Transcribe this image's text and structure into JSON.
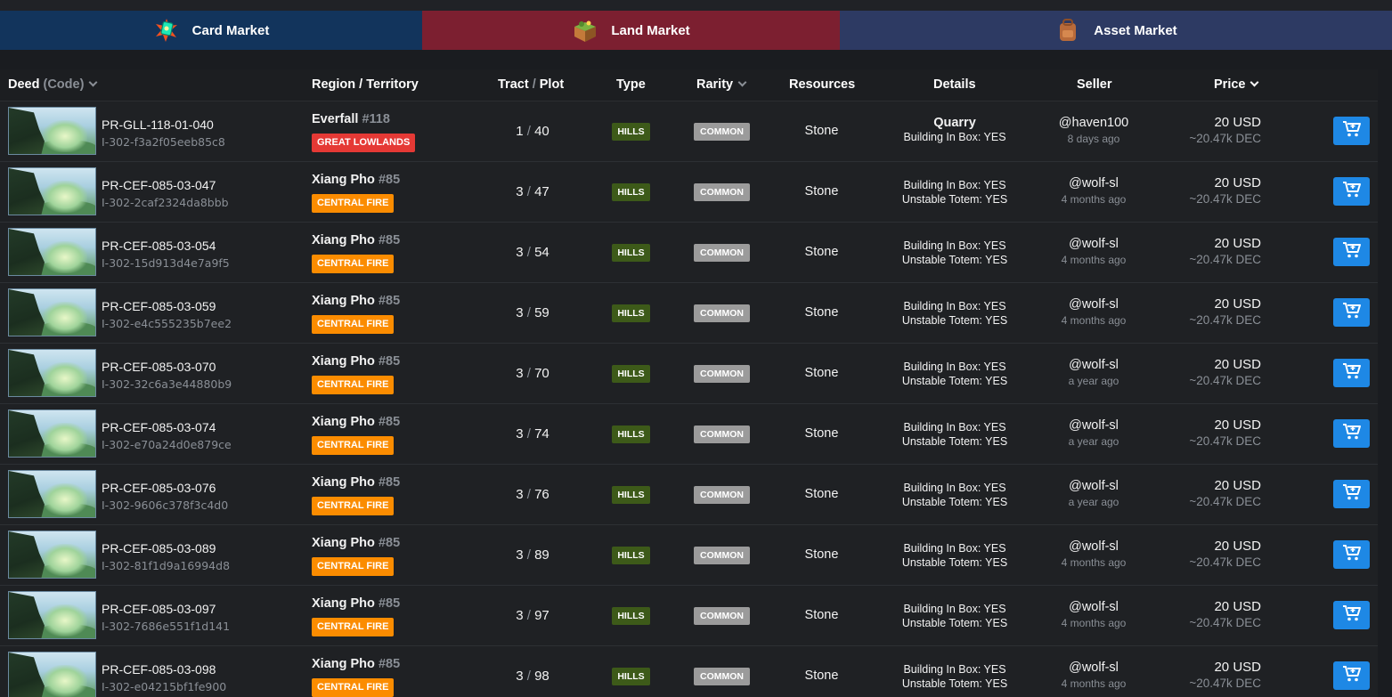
{
  "tabs": [
    {
      "label": "Card Market",
      "icon": "card-pack-icon"
    },
    {
      "label": "Land Market",
      "icon": "land-cube-icon"
    },
    {
      "label": "Asset Market",
      "icon": "backpack-icon"
    }
  ],
  "headers": {
    "deed": "Deed",
    "code": "(Code)",
    "region": "Region / Territory",
    "tract": "Tract",
    "plot": "Plot",
    "tract_sep": "/",
    "type": "Type",
    "rarity": "Rarity",
    "resources": "Resources",
    "details": "Details",
    "seller": "Seller",
    "price": "Price"
  },
  "colors": {
    "great_lowlands": "#e53935",
    "central_fire": "#fb8c00",
    "hills": "#3d5a19",
    "common": "#9b9b9b",
    "cart_button": "#1e88e5"
  },
  "rows": [
    {
      "deed": "PR-GLL-118-01-040",
      "id": "I-302-f3a2f05eeb85c8",
      "region": "Everfall",
      "region_num": "#118",
      "territory": "GREAT LOWLANDS",
      "tract": "1",
      "plot": "40",
      "type": "HILLS",
      "rarity": "COMMON",
      "resource": "Stone",
      "detail_main": "Quarry",
      "details": [
        "Building In Box: YES"
      ],
      "seller": "@haven100",
      "ago": "8 days ago",
      "price": "20 USD",
      "dec": "~20.47k DEC"
    },
    {
      "deed": "PR-CEF-085-03-047",
      "id": "I-302-2caf2324da8bbb",
      "region": "Xiang Pho",
      "region_num": "#85",
      "territory": "CENTRAL FIRE",
      "tract": "3",
      "plot": "47",
      "type": "HILLS",
      "rarity": "COMMON",
      "resource": "Stone",
      "detail_main": "",
      "details": [
        "Building In Box: YES",
        "Unstable Totem: YES"
      ],
      "seller": "@wolf-sl",
      "ago": "4 months ago",
      "price": "20 USD",
      "dec": "~20.47k DEC"
    },
    {
      "deed": "PR-CEF-085-03-054",
      "id": "I-302-15d913d4e7a9f5",
      "region": "Xiang Pho",
      "region_num": "#85",
      "territory": "CENTRAL FIRE",
      "tract": "3",
      "plot": "54",
      "type": "HILLS",
      "rarity": "COMMON",
      "resource": "Stone",
      "detail_main": "",
      "details": [
        "Building In Box: YES",
        "Unstable Totem: YES"
      ],
      "seller": "@wolf-sl",
      "ago": "4 months ago",
      "price": "20 USD",
      "dec": "~20.47k DEC"
    },
    {
      "deed": "PR-CEF-085-03-059",
      "id": "I-302-e4c555235b7ee2",
      "region": "Xiang Pho",
      "region_num": "#85",
      "territory": "CENTRAL FIRE",
      "tract": "3",
      "plot": "59",
      "type": "HILLS",
      "rarity": "COMMON",
      "resource": "Stone",
      "detail_main": "",
      "details": [
        "Building In Box: YES",
        "Unstable Totem: YES"
      ],
      "seller": "@wolf-sl",
      "ago": "4 months ago",
      "price": "20 USD",
      "dec": "~20.47k DEC"
    },
    {
      "deed": "PR-CEF-085-03-070",
      "id": "I-302-32c6a3e44880b9",
      "region": "Xiang Pho",
      "region_num": "#85",
      "territory": "CENTRAL FIRE",
      "tract": "3",
      "plot": "70",
      "type": "HILLS",
      "rarity": "COMMON",
      "resource": "Stone",
      "detail_main": "",
      "details": [
        "Building In Box: YES",
        "Unstable Totem: YES"
      ],
      "seller": "@wolf-sl",
      "ago": "a year ago",
      "price": "20 USD",
      "dec": "~20.47k DEC"
    },
    {
      "deed": "PR-CEF-085-03-074",
      "id": "I-302-e70a24d0e879ce",
      "region": "Xiang Pho",
      "region_num": "#85",
      "territory": "CENTRAL FIRE",
      "tract": "3",
      "plot": "74",
      "type": "HILLS",
      "rarity": "COMMON",
      "resource": "Stone",
      "detail_main": "",
      "details": [
        "Building In Box: YES",
        "Unstable Totem: YES"
      ],
      "seller": "@wolf-sl",
      "ago": "a year ago",
      "price": "20 USD",
      "dec": "~20.47k DEC"
    },
    {
      "deed": "PR-CEF-085-03-076",
      "id": "I-302-9606c378f3c4d0",
      "region": "Xiang Pho",
      "region_num": "#85",
      "territory": "CENTRAL FIRE",
      "tract": "3",
      "plot": "76",
      "type": "HILLS",
      "rarity": "COMMON",
      "resource": "Stone",
      "detail_main": "",
      "details": [
        "Building In Box: YES",
        "Unstable Totem: YES"
      ],
      "seller": "@wolf-sl",
      "ago": "a year ago",
      "price": "20 USD",
      "dec": "~20.47k DEC"
    },
    {
      "deed": "PR-CEF-085-03-089",
      "id": "I-302-81f1d9a16994d8",
      "region": "Xiang Pho",
      "region_num": "#85",
      "territory": "CENTRAL FIRE",
      "tract": "3",
      "plot": "89",
      "type": "HILLS",
      "rarity": "COMMON",
      "resource": "Stone",
      "detail_main": "",
      "details": [
        "Building In Box: YES",
        "Unstable Totem: YES"
      ],
      "seller": "@wolf-sl",
      "ago": "4 months ago",
      "price": "20 USD",
      "dec": "~20.47k DEC"
    },
    {
      "deed": "PR-CEF-085-03-097",
      "id": "I-302-7686e551f1d141",
      "region": "Xiang Pho",
      "region_num": "#85",
      "territory": "CENTRAL FIRE",
      "tract": "3",
      "plot": "97",
      "type": "HILLS",
      "rarity": "COMMON",
      "resource": "Stone",
      "detail_main": "",
      "details": [
        "Building In Box: YES",
        "Unstable Totem: YES"
      ],
      "seller": "@wolf-sl",
      "ago": "4 months ago",
      "price": "20 USD",
      "dec": "~20.47k DEC"
    },
    {
      "deed": "PR-CEF-085-03-098",
      "id": "I-302-e04215bf1fe900",
      "region": "Xiang Pho",
      "region_num": "#85",
      "territory": "CENTRAL FIRE",
      "tract": "3",
      "plot": "98",
      "type": "HILLS",
      "rarity": "COMMON",
      "resource": "Stone",
      "detail_main": "",
      "details": [
        "Building In Box: YES",
        "Unstable Totem: YES"
      ],
      "seller": "@wolf-sl",
      "ago": "4 months ago",
      "price": "20 USD",
      "dec": "~20.47k DEC"
    }
  ]
}
